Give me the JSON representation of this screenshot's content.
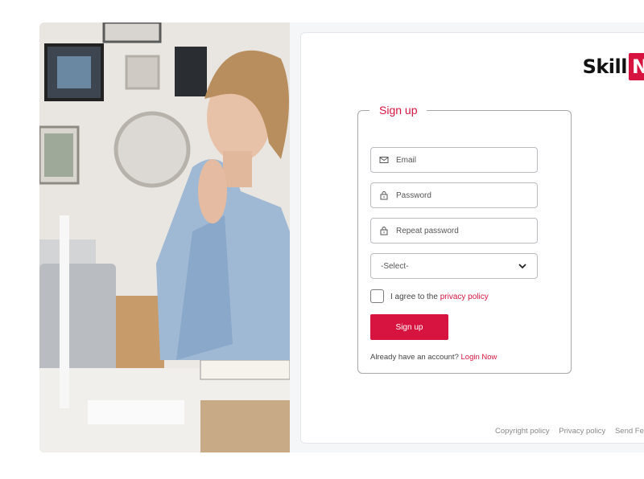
{
  "brand": {
    "part1": "Skill",
    "part2": "Ne"
  },
  "form": {
    "legend": "Sign up",
    "email_placeholder": "Email",
    "password_placeholder": "Password",
    "repeat_password_placeholder": "Repeat password",
    "select_value": "-Select-",
    "agree_text": "I agree to the",
    "privacy_link": "privacy policy",
    "signup_button": "Sign up",
    "have_account": "Already have an account?",
    "login_link": "Login Now"
  },
  "footer": {
    "links": [
      "Copyright policy",
      "Privacy policy",
      "Send Feed"
    ]
  },
  "icons": {
    "email": "mail-icon",
    "password": "lock-icon",
    "repeat_password": "lock-icon",
    "select": "chevron-down-icon"
  },
  "colors": {
    "accent": "#d7143f"
  }
}
